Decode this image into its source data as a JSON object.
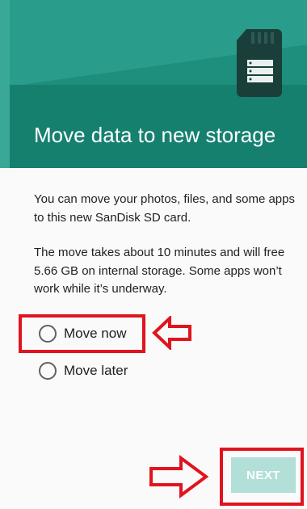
{
  "header": {
    "title": "Move data to new storage",
    "icon": "sd-card-icon",
    "colors": {
      "background": "#1e8e7d",
      "text": "#ffffff"
    }
  },
  "content": {
    "paragraph1": "You can move your photos, files, and some apps to this new SanDisk SD card.",
    "paragraph2": "The move takes about 10 minutes and will free 5.66 GB on internal storage. Some apps won’t work while it’s underway."
  },
  "options": [
    {
      "label": "Move now",
      "selected": false,
      "highlighted": true
    },
    {
      "label": "Move later",
      "selected": false,
      "highlighted": false
    }
  ],
  "footer": {
    "next_label": "NEXT",
    "next_enabled": false,
    "highlighted": true
  },
  "annotations": {
    "color": "#e0141e",
    "type": "red-box-with-arrow"
  }
}
